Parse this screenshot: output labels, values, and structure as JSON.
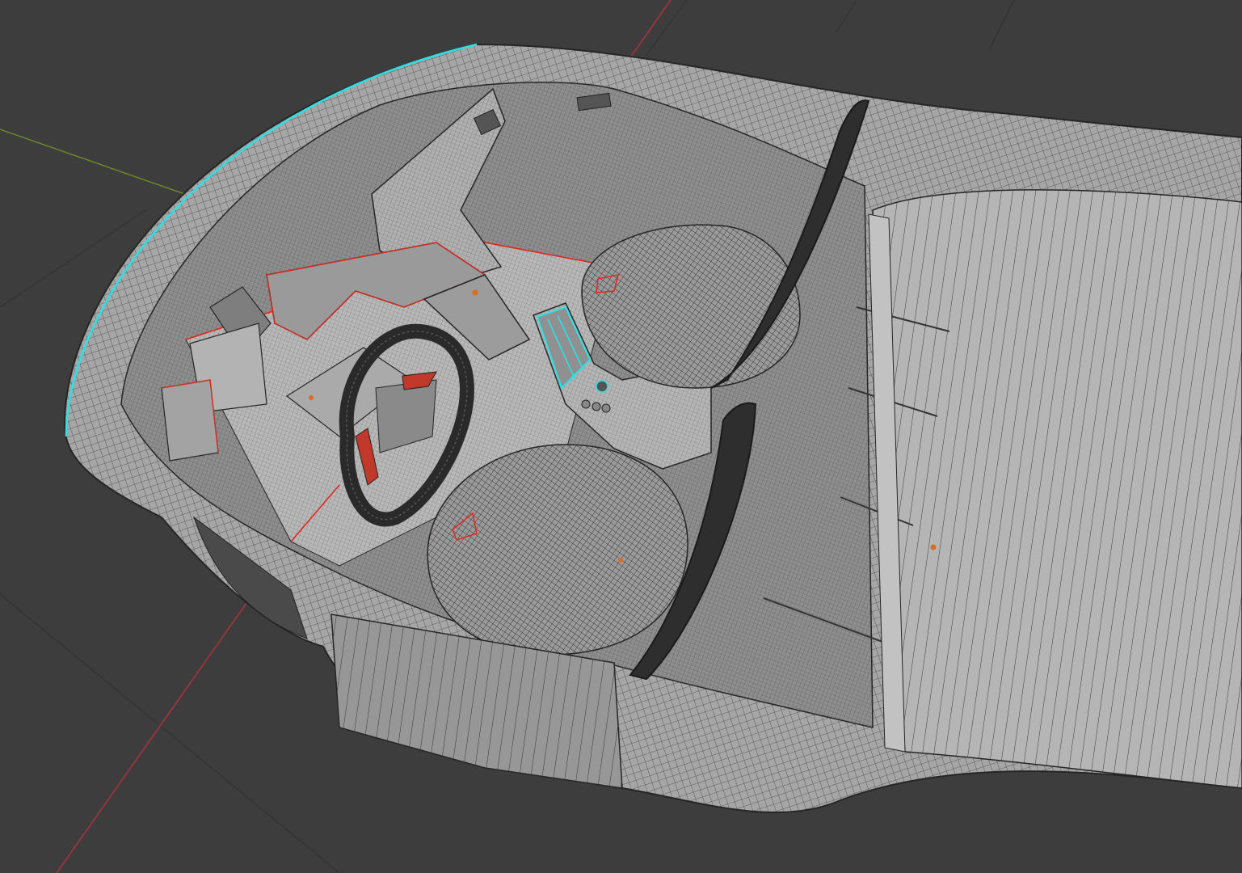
{
  "viewport": {
    "background": "#3d3d3d",
    "grid_color": "#333333",
    "axis_x_color": "#a8323c",
    "axis_y_color": "#6b8e23",
    "mesh_fill": "#a6a6a6",
    "mesh_fill_dark": "#8c8c8c",
    "wire_color": "#262626",
    "seam_color": "#e0281e",
    "selected_edge_color": "#29e1e6",
    "origin_color": "#e06a1e"
  },
  "scene": {
    "object": "car-interior-mesh",
    "shading": "wireframe-overlay",
    "visible_parts": [
      "body-shell",
      "dashboard",
      "steering-wheel",
      "center-console",
      "driver-seat",
      "passenger-seat",
      "rear-deck",
      "floor"
    ]
  }
}
